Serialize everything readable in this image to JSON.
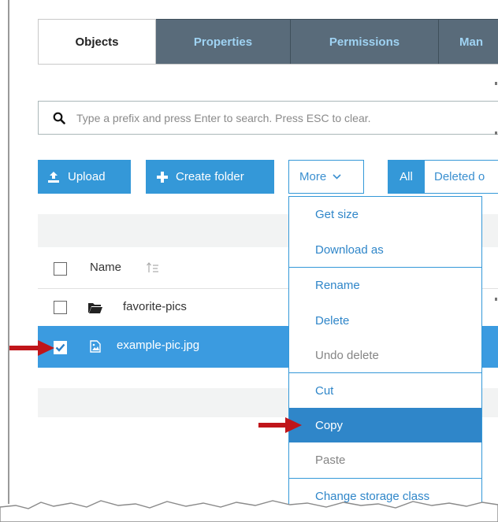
{
  "tabs": [
    {
      "label": "Objects",
      "active": true
    },
    {
      "label": "Properties",
      "active": false
    },
    {
      "label": "Permissions",
      "active": false
    },
    {
      "label": "Man",
      "active": false
    }
  ],
  "search": {
    "placeholder": "Type a prefix and press Enter to search. Press ESC to clear.",
    "icon": "search-icon"
  },
  "toolbar": {
    "upload_label": "Upload",
    "create_folder_label": "Create folder",
    "more_label": "More",
    "filter_all_label": "All",
    "filter_deleted_label": "Deleted o"
  },
  "table": {
    "name_header": "Name",
    "rows": [
      {
        "name": "favorite-pics",
        "type": "folder",
        "checked": false
      },
      {
        "name": "example-pic.jpg",
        "type": "image",
        "checked": true
      }
    ]
  },
  "more_menu": {
    "items": [
      {
        "label": "Get size",
        "disabled": false,
        "selected": false
      },
      {
        "label": "Download as",
        "disabled": false,
        "selected": false
      },
      {
        "label": "Rename",
        "disabled": false,
        "selected": false
      },
      {
        "label": "Delete",
        "disabled": false,
        "selected": false
      },
      {
        "label": "Undo delete",
        "disabled": true,
        "selected": false
      },
      {
        "label": "Cut",
        "disabled": false,
        "selected": false
      },
      {
        "label": "Copy",
        "disabled": false,
        "selected": true
      },
      {
        "label": "Paste",
        "disabled": true,
        "selected": false
      },
      {
        "label": "Change storage class",
        "disabled": false,
        "selected": false
      }
    ]
  },
  "colors": {
    "accent": "#3498d8",
    "tab_bar": "#596b7a",
    "selected_row": "#3b9be0",
    "annotation_arrow": "#c0151a"
  }
}
